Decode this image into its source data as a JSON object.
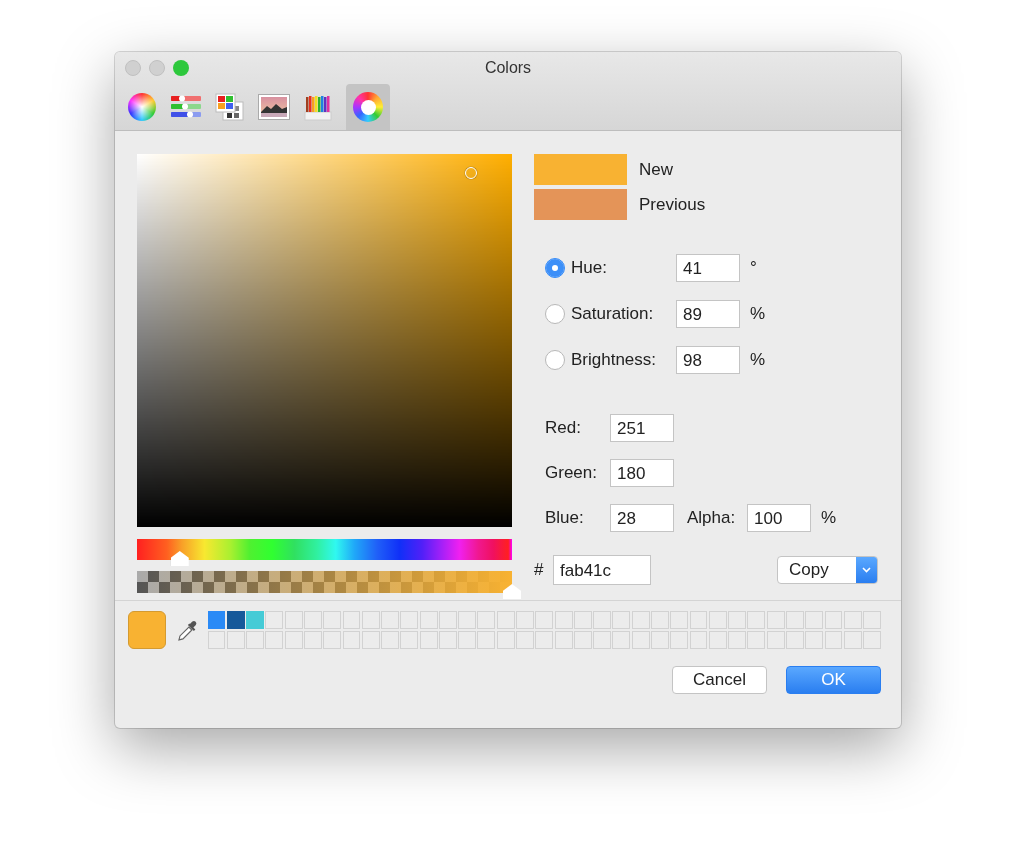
{
  "window": {
    "title": "Colors"
  },
  "tabs": [
    {
      "kind": "wheel",
      "selected": false
    },
    {
      "kind": "sliders",
      "selected": false
    },
    {
      "kind": "palettes",
      "selected": false
    },
    {
      "kind": "image",
      "selected": false
    },
    {
      "kind": "pencils",
      "selected": false
    },
    {
      "kind": "spectrum",
      "selected": true
    }
  ],
  "hue_slider": {
    "level": 0.114
  },
  "alpha_slider": {
    "level": 1
  },
  "preview": [
    {
      "label": "New",
      "color": "#f8b232"
    },
    {
      "label": "Previous",
      "color": "#e49458"
    }
  ],
  "hsb": [
    {
      "label": "Hue:",
      "value": "41",
      "unit": "°",
      "selected": true
    },
    {
      "label": "Saturation:",
      "value": "89",
      "unit": "%",
      "selected": false
    },
    {
      "label": "Brightness:",
      "value": "98",
      "unit": "%",
      "selected": false
    }
  ],
  "rgb": [
    {
      "label": "Red:",
      "value": "251"
    },
    {
      "label": "Green:",
      "value": "180"
    },
    {
      "label": "Blue:",
      "value": "28"
    }
  ],
  "alpha": {
    "label": "Alpha:",
    "value": "100",
    "unit": "%"
  },
  "hex": {
    "prefix": "#",
    "value": "fab41c"
  },
  "copy_button": {
    "label": "Copy"
  },
  "current_color": {
    "color": "#f8b232"
  },
  "swatches": [
    {
      "color": "#2a8af6"
    },
    {
      "color": "#16599a"
    },
    {
      "color": "#45cbd6"
    }
  ],
  "buttons": [
    {
      "label": "Cancel",
      "default": false
    },
    {
      "label": "OK",
      "default": true
    }
  ]
}
